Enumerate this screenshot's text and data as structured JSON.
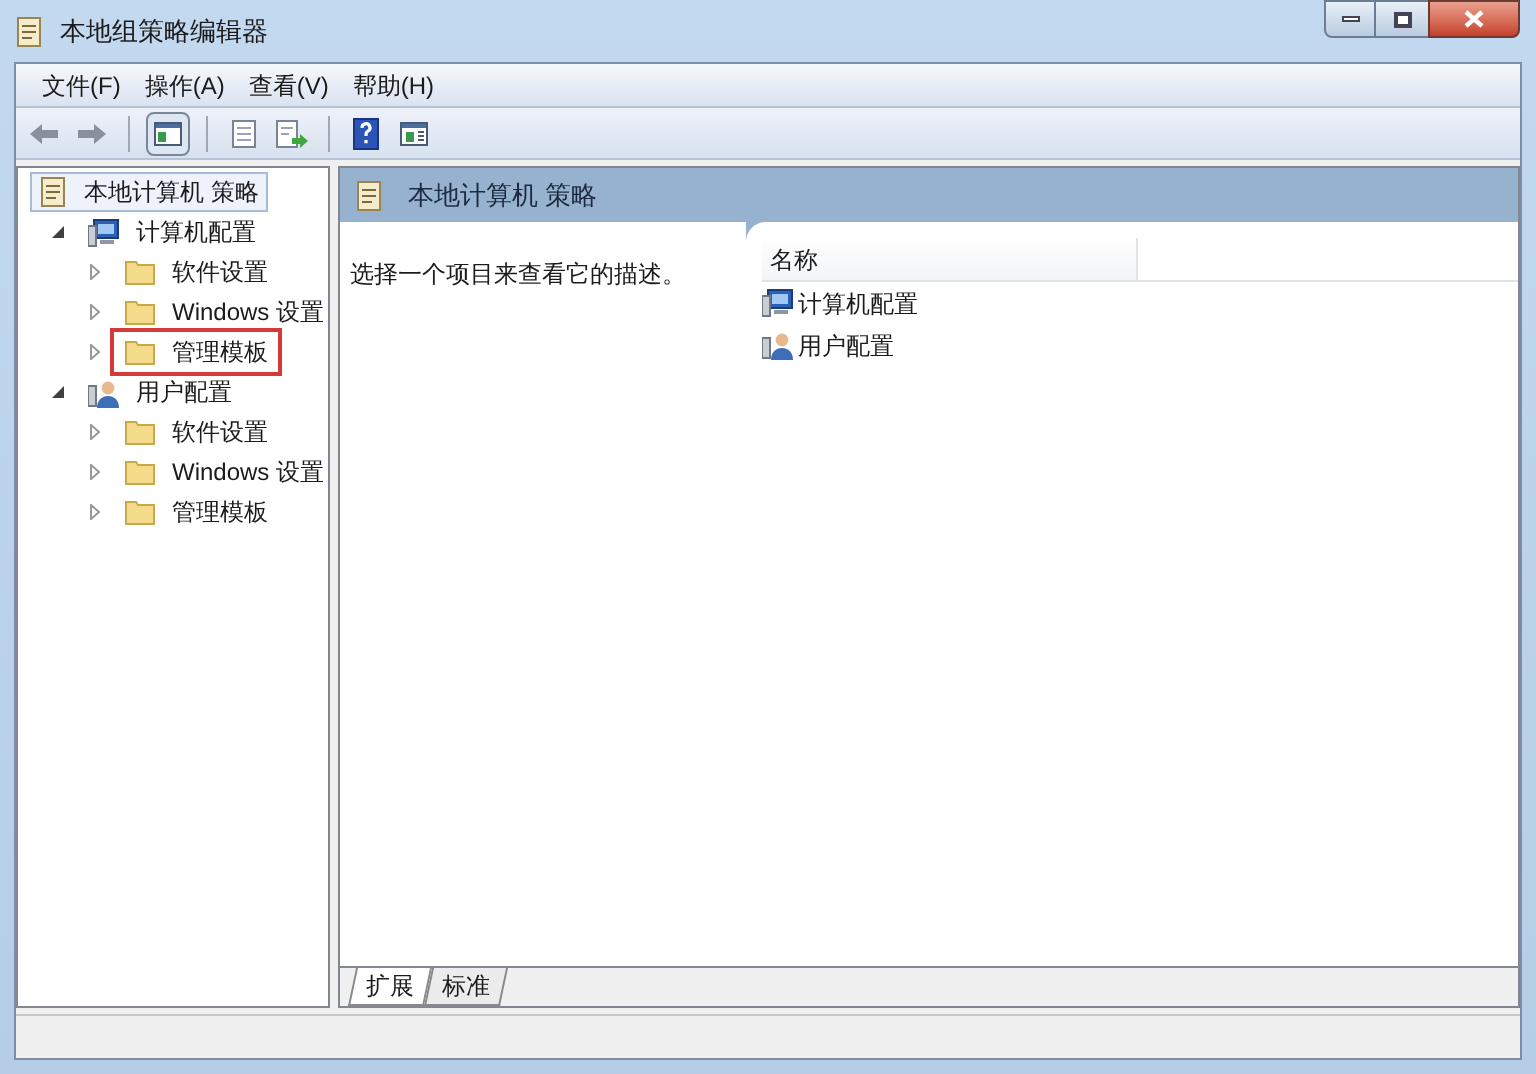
{
  "window": {
    "title": "本地组策略编辑器"
  },
  "menu": [
    "文件(F)",
    "操作(A)",
    "查看(V)",
    "帮助(H)"
  ],
  "tree": {
    "label": "本地计算机 策略",
    "kind": "policy",
    "selected": true,
    "marked": false,
    "children": [
      {
        "label": "计算机配置",
        "kind": "computer",
        "expanded": true,
        "selected": false,
        "marked": false,
        "children": [
          {
            "label": "软件设置",
            "kind": "folder",
            "expanded": false,
            "selected": false,
            "marked": false
          },
          {
            "label": "Windows 设置",
            "kind": "folder",
            "expanded": false,
            "selected": false,
            "marked": false
          },
          {
            "label": "管理模板",
            "kind": "folder",
            "expanded": false,
            "selected": false,
            "marked": true
          }
        ]
      },
      {
        "label": "用户配置",
        "kind": "user",
        "expanded": true,
        "selected": false,
        "marked": false,
        "children": [
          {
            "label": "软件设置",
            "kind": "folder",
            "expanded": false,
            "selected": false,
            "marked": false
          },
          {
            "label": "Windows 设置",
            "kind": "folder",
            "expanded": false,
            "selected": false,
            "marked": false
          },
          {
            "label": "管理模板",
            "kind": "folder",
            "expanded": false,
            "selected": false,
            "marked": false
          }
        ]
      }
    ]
  },
  "details": {
    "header": "本地计算机 策略",
    "description": "选择一个项目来查看它的描述。",
    "column": "名称",
    "items": [
      {
        "label": "计算机配置",
        "kind": "computer"
      },
      {
        "label": "用户配置",
        "kind": "user"
      }
    ]
  },
  "tabs": [
    {
      "label": "扩展",
      "selected": true
    },
    {
      "label": "标准",
      "selected": false
    }
  ]
}
